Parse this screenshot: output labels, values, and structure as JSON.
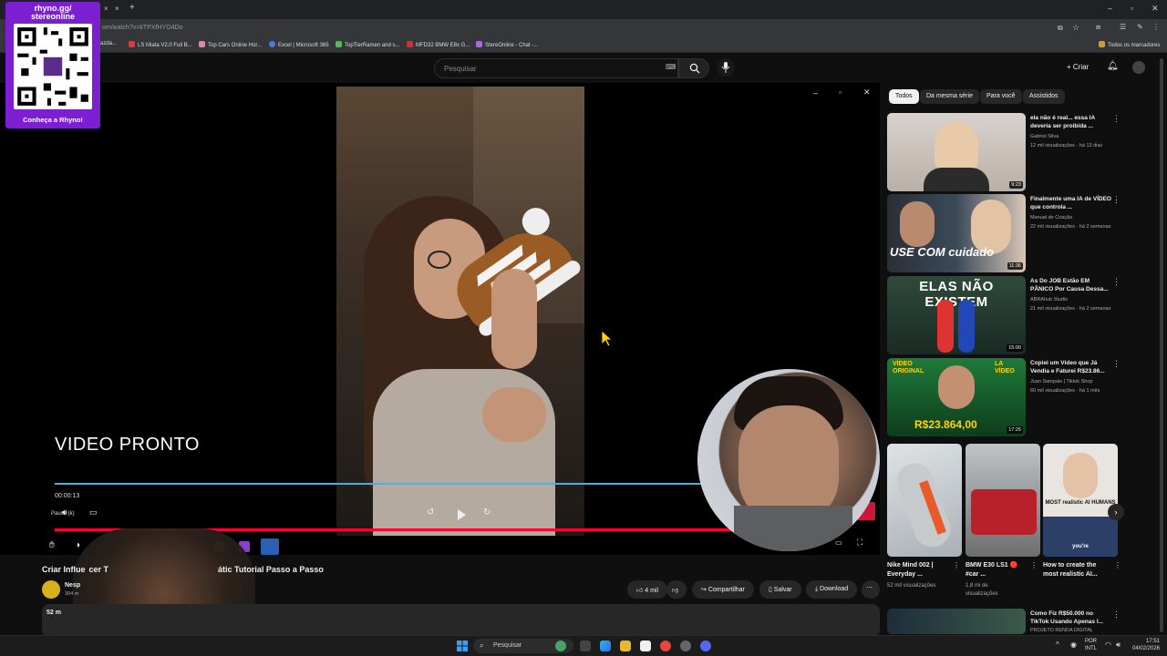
{
  "browser": {
    "url": "om/watch?v=kTPXfHYO4Do",
    "bookmarks": [
      "azda...",
      "LS Miata V2.0 Full B...",
      "Top Cars Online Hor...",
      "Excel | Microsoft 365",
      "TopTierRamen and s...",
      "MFD32 BMW E8x G...",
      "StereOnline - Chat -..."
    ],
    "all_bookmarks": "Todos os marcadores"
  },
  "qr_overlay": {
    "title": "rhyno.gg/\nstereonline",
    "caption": "Conheça a Rhyno!"
  },
  "header": {
    "search_placeholder": "Pesquisar",
    "create_label": "Criar"
  },
  "player": {
    "overlay_text": "VIDEO PRONTO",
    "time": "00:00:13",
    "pause_label": "Pausa (k)",
    "progress_fraction": 0.93
  },
  "video": {
    "title_left": "Criar Influe",
    "title_mid": "cer T",
    "title_right": "átic  Tutorial Passo a Passo",
    "channel": "Nesp",
    "subs": "304 m",
    "views_partial": "52 m",
    "like_count": "4 mil",
    "share_label": "Compartilhar",
    "save_label": "Salvar",
    "download_label": "Download"
  },
  "sidebar": {
    "chips": [
      "Todos",
      "Da mesma série",
      "Para você",
      "Assistidos"
    ],
    "recs": [
      {
        "title": "ela não é real... essa IA deveria ser proibida ...",
        "channel": "Gabriel Silva",
        "meta": "12 mil visualizações · há 13 dias",
        "duration": "9:23"
      },
      {
        "title": "Finalmente uma IA de VÍDEO que controla ...",
        "channel": "Manual de Criação",
        "meta": "22 mil visualizações · há 2 semanas",
        "duration": "11:36",
        "thumb_text": "USE COM cuidado"
      },
      {
        "title": "As Do JOB Estão EM PÂNICO Por Causa Dessa...",
        "channel": "ABRAhub Studio",
        "meta": "21 mil visualizações · há 2 semanas",
        "duration": "15:00",
        "thumb_text": "ELAS NÃO EXISTEM"
      },
      {
        "title": "Copiei um Vídeo que Já Vendia e Faturei R$23.86...",
        "channel": "Juan Sampaio | Tiktok Shop",
        "meta": "60 mil visualizações · há 1 mês",
        "duration": "17:25",
        "thumb_text_left": "VÍDEO ORIGINAL",
        "thumb_text_right": "LA VÍDEO",
        "thumb_money": "R$23.864,00"
      }
    ],
    "shorts": [
      {
        "title": "Nike Mind 002 | Everyday ...",
        "meta": "52 mil visualizações"
      },
      {
        "title": "BMW E30 LS1 🔴 #car ...",
        "meta": "1,8 mi de visualizações"
      },
      {
        "title": "How to create the most realistic AI...",
        "meta": "",
        "thumb_text": "MOST realistic AI HUMANS",
        "thumb_sub": "you're"
      }
    ],
    "last_rec": {
      "title": "Como Fiz R$50.000 no TikTok Usando Apenas I...",
      "channel": "PROJETO RENDA DIGITAL"
    }
  },
  "taskbar": {
    "search": "Pesquisar",
    "lang_top": "POR",
    "lang_bottom": "INTL",
    "time": "17:51",
    "date": "04/02/2026"
  },
  "colors": {
    "accent_red": "#ff0033",
    "qr_purple": "#7b1fd1",
    "progress_blue": "#4ab0e0"
  }
}
